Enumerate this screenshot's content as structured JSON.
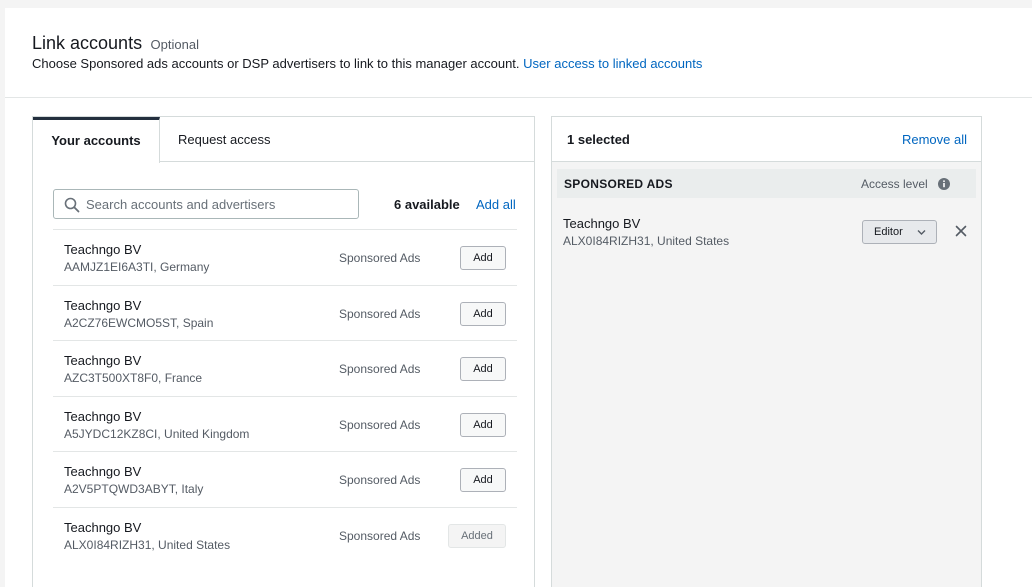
{
  "header": {
    "title": "Link accounts",
    "optional": "Optional",
    "subtitle": "Choose Sponsored ads accounts or DSP advertisers to link to this manager account.",
    "help_link": "User access to linked accounts"
  },
  "left_panel": {
    "tabs": [
      {
        "label": "Your accounts",
        "active": true
      },
      {
        "label": "Request access",
        "active": false
      }
    ],
    "search": {
      "placeholder": "Search accounts and advertisers",
      "value": ""
    },
    "available": "6 available",
    "add_all": "Add all",
    "rows": [
      {
        "name": "Teachngo BV",
        "id": "AAMJZ1EI6A3TI, Germany",
        "type": "Sponsored Ads",
        "action": "Add"
      },
      {
        "name": "Teachngo BV",
        "id": "A2CZ76EWCMO5ST, Spain",
        "type": "Sponsored Ads",
        "action": "Add"
      },
      {
        "name": "Teachngo BV",
        "id": "AZC3T500XT8F0, France",
        "type": "Sponsored Ads",
        "action": "Add"
      },
      {
        "name": "Teachngo BV",
        "id": "A5JYDC12KZ8CI, United Kingdom",
        "type": "Sponsored Ads",
        "action": "Add"
      },
      {
        "name": "Teachngo BV",
        "id": "A2V5PTQWD3ABYT, Italy",
        "type": "Sponsored Ads",
        "action": "Add"
      },
      {
        "name": "Teachngo BV",
        "id": "ALX0I84RIZH31, United States",
        "type": "Sponsored Ads",
        "action": "Added"
      }
    ]
  },
  "right_panel": {
    "selected": "1 selected",
    "remove_all": "Remove all",
    "section_title": "SPONSORED ADS",
    "access_level": "Access level",
    "selected_item": {
      "name": "Teachngo BV",
      "id": "ALX0I84RIZH31, United States",
      "role": "Editor"
    }
  },
  "colors": {
    "link": "#0066c0",
    "text": "#16191f",
    "muted": "#545b64",
    "border": "#d5dbdb"
  },
  "icons": [
    "search-icon",
    "info-icon",
    "chevron-down-icon",
    "close-icon"
  ]
}
